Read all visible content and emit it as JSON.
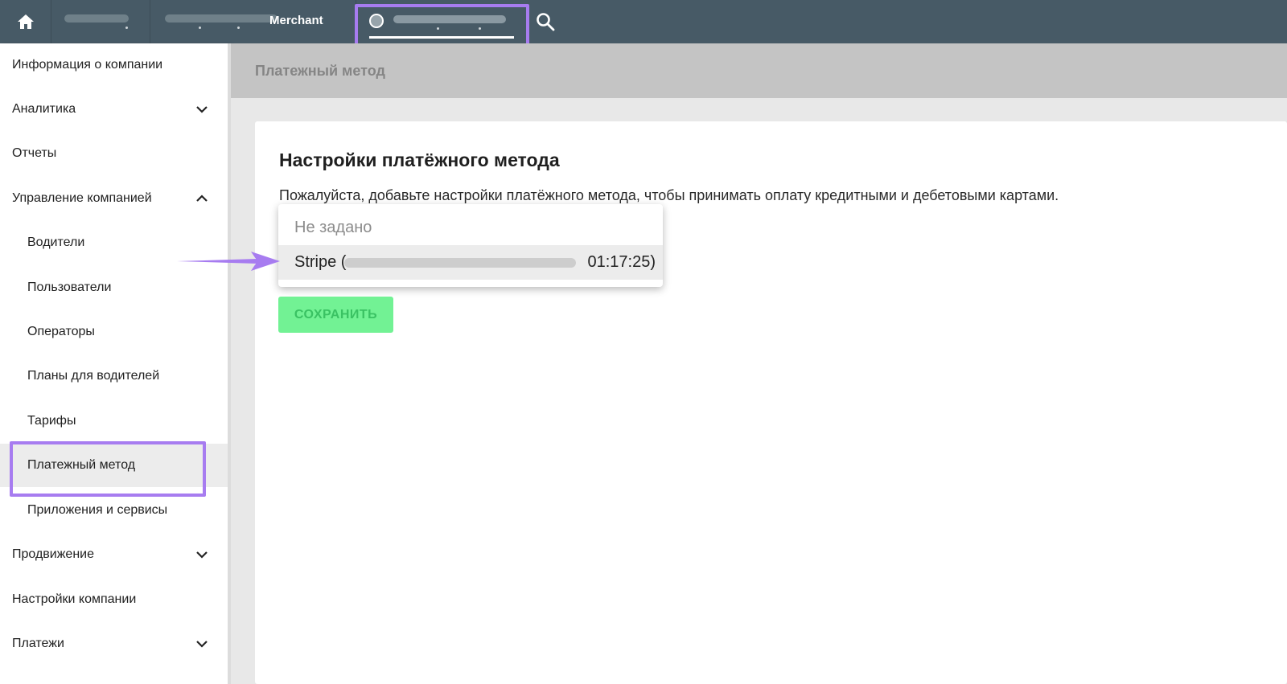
{
  "topbar": {
    "tabs": [
      {
        "label": ""
      },
      {
        "label": "Merchant"
      },
      {
        "label": ""
      }
    ]
  },
  "sidebar": {
    "items": [
      {
        "label": "Информация о компании",
        "chevron": null
      },
      {
        "label": "Аналитика",
        "chevron": "down"
      },
      {
        "label": "Отчеты",
        "chevron": null
      },
      {
        "label": "Управление компанией",
        "chevron": "up"
      },
      {
        "label": "Водители",
        "chevron": null
      },
      {
        "label": "Пользователи",
        "chevron": null
      },
      {
        "label": "Операторы",
        "chevron": null
      },
      {
        "label": "Планы для водителей",
        "chevron": null
      },
      {
        "label": "Тарифы",
        "chevron": null
      },
      {
        "label": "Платежный метод",
        "chevron": null,
        "active": true
      },
      {
        "label": "Приложения и сервисы",
        "chevron": null
      },
      {
        "label": "Продвижение",
        "chevron": "down"
      },
      {
        "label": "Настройки компании",
        "chevron": null
      },
      {
        "label": "Платежи",
        "chevron": "down"
      }
    ]
  },
  "main": {
    "header_title": "Платежный метод",
    "card": {
      "title": "Настройки платёжного метода",
      "description": "Пожалуйста, добавьте настройки платёжного метода, чтобы принимать оплату кредитными и дебетовыми картами.",
      "dropdown": {
        "placeholder": "Не задано",
        "selected_prefix": "Stripe (",
        "selected_suffix": "01:17:25)"
      },
      "save_label": "СОХРАНИТЬ"
    }
  },
  "colors": {
    "topbar": "#475a66",
    "highlight": "#a77cf0",
    "save_button": "#72f294",
    "save_text": "#3ac263"
  },
  "icons": {
    "home": "home-icon",
    "search": "search-icon",
    "chevron_down": "chevron-down-icon",
    "chevron_up": "chevron-up-icon",
    "arrow": "arrow-right-icon"
  }
}
